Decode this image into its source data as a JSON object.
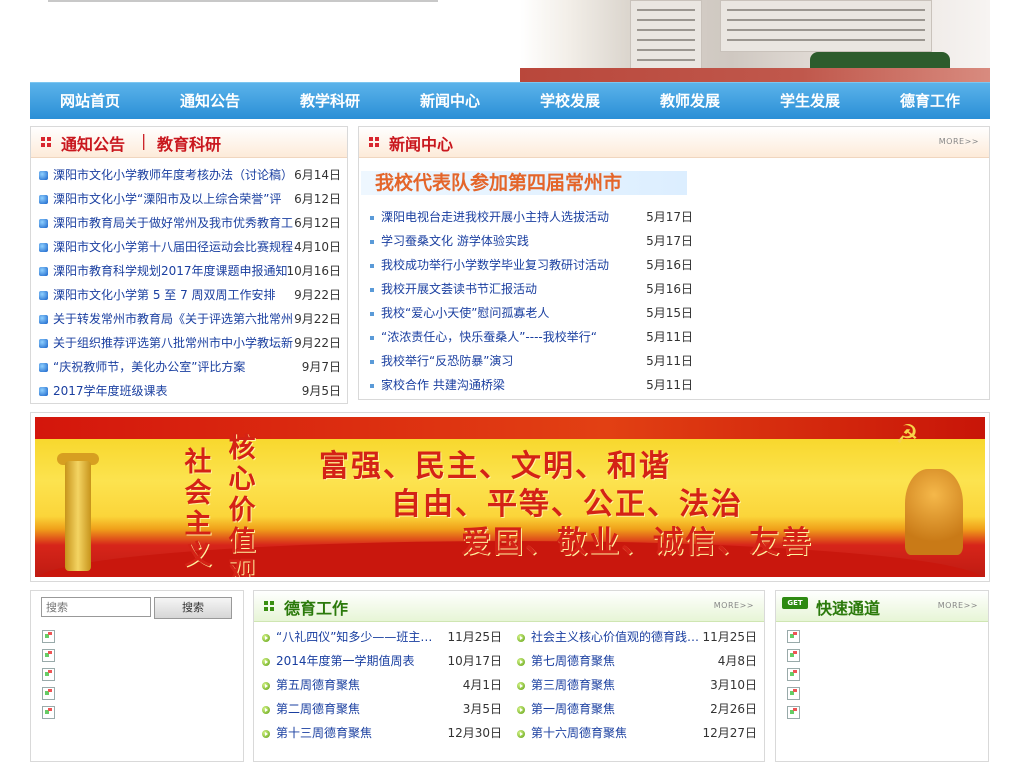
{
  "nav": {
    "items": [
      "网站首页",
      "通知公告",
      "教学科研",
      "新闻中心",
      "学校发展",
      "教师发展",
      "学生发展",
      "德育工作"
    ]
  },
  "notices": {
    "title_a": "通知公告",
    "separator": "|",
    "title_b": "教育科研",
    "items": [
      {
        "text": "溧阳市文化小学教师年度考核办法（讨论稿）",
        "date": "6月14日"
      },
      {
        "text": "溧阳市文化小学“溧阳市及以上综合荣誉”评",
        "date": "6月12日"
      },
      {
        "text": "溧阳市教育局关于做好常州及我市优秀教育工",
        "date": "6月12日"
      },
      {
        "text": "溧阳市文化小学第十八届田径运动会比赛规程",
        "date": "4月10日"
      },
      {
        "text": "溧阳市教育科学规划2017年度课题申报通知",
        "date": "10月16日"
      },
      {
        "text": "溧阳市文化小学第 5 至 7 周双周工作安排",
        "date": "9月22日"
      },
      {
        "text": "关于转发常州市教育局《关于评选第六批常州",
        "date": "9月22日"
      },
      {
        "text": "关于组织推荐评选第八批常州市中小学教坛新",
        "date": "9月22日"
      },
      {
        "text": "“庆祝教师节，美化办公室”评比方案",
        "date": "9月7日"
      },
      {
        "text": "2017学年度班级课表",
        "date": "9月5日"
      }
    ]
  },
  "news": {
    "title": "新闻中心",
    "more": "MORE>>",
    "headline": "我校代表队参加第四届常州市",
    "items": [
      {
        "text": "溧阳电视台走进我校开展小主持人选拔活动",
        "date": "5月17日"
      },
      {
        "text": "学习蚕桑文化 游学体验实践",
        "date": "5月17日"
      },
      {
        "text": "我校成功举行小学数学毕业复习教研讨活动",
        "date": "5月16日"
      },
      {
        "text": "我校开展文荟读书节汇报活动",
        "date": "5月16日"
      },
      {
        "text": "我校“爱心小天使”慰问孤寡老人",
        "date": "5月15日"
      },
      {
        "text": "“浓浓责任心，快乐蚕桑人”----我校举行“",
        "date": "5月11日"
      },
      {
        "text": "我校举行“反恐防暴”演习",
        "date": "5月11日"
      },
      {
        "text": "家校合作 共建沟通桥梁",
        "date": "5月11日"
      }
    ]
  },
  "banner": {
    "vertical_a": [
      "社",
      "会",
      "主",
      "义"
    ],
    "vertical_b": [
      "核",
      "心",
      "价",
      "值",
      "观"
    ],
    "line1": "富强、民主、文明、和谐",
    "line2": "自由、平等、公正、法治",
    "line3": "爱国、敬业、诚信、友善",
    "emblem": "☭"
  },
  "search": {
    "placeholder": "搜索",
    "button": "搜索"
  },
  "moral": {
    "title": "德育工作",
    "more": "MORE>>",
    "left": [
      {
        "text": "“八礼四仪”知多少——班主…",
        "date": "11月25日"
      },
      {
        "text": "2014年度第一学期值周表",
        "date": "10月17日"
      },
      {
        "text": "第五周德育聚焦",
        "date": "4月1日"
      },
      {
        "text": "第二周德育聚焦",
        "date": "3月5日"
      },
      {
        "text": "第十三周德育聚焦",
        "date": "12月30日"
      }
    ],
    "right": [
      {
        "text": "社会主义核心价值观的德育践…",
        "date": "11月25日"
      },
      {
        "text": "第七周德育聚焦",
        "date": "4月8日"
      },
      {
        "text": "第三周德育聚焦",
        "date": "3月10日"
      },
      {
        "text": "第一周德育聚焦",
        "date": "2月26日"
      },
      {
        "text": "第十六周德育聚焦",
        "date": "12月27日"
      }
    ]
  },
  "quick": {
    "title": "快速通道",
    "badge": "GET",
    "more": "MORE>>"
  },
  "colors": {
    "nav_blue": "#2a8fd6",
    "notice_red": "#c9171e",
    "green": "#2b7a0b",
    "link_blue": "#1a3fa0"
  }
}
